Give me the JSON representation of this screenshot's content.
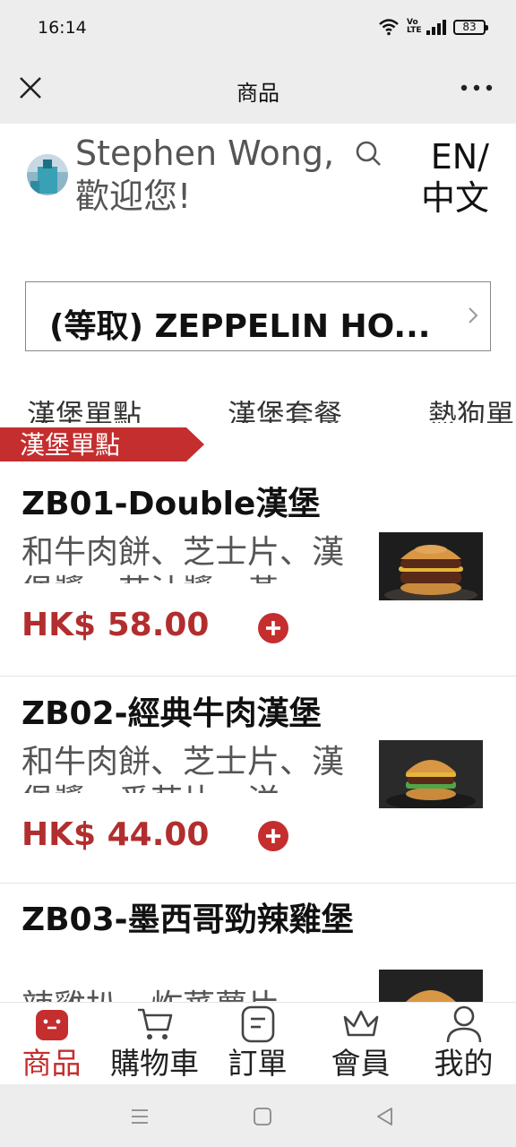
{
  "status_bar": {
    "time": "16:14",
    "network": "Vo LTE",
    "battery": "83"
  },
  "title_bar": {
    "title": "商品"
  },
  "welcome": {
    "name_line": "Stephen Wong,",
    "greeting_line": "歡迎您!",
    "lang_line1": "EN/",
    "lang_line2": "中文"
  },
  "store": {
    "name": "(等取) ZEPPELIN HO..."
  },
  "category_tabs": [
    "漢堡單點",
    "漢堡套餐",
    "熱狗單"
  ],
  "section_label": "漢堡單點",
  "accent_color": "#c42e2e",
  "products": [
    {
      "name": "ZB01-Double漢堡",
      "description": "和牛肉餅、芝士片、漢堡醬、茄汁醬、黃",
      "price": "HK$ 58.00"
    },
    {
      "name": "ZB02-經典牛肉漢堡",
      "description": "和牛肉餅、芝士片、漢堡醬、番茄片、洋",
      "price": "HK$ 44.00"
    },
    {
      "name": "ZB03-墨西哥勁辣雞堡",
      "description": "辣雞扒、炸蕃薯片",
      "price": ""
    }
  ],
  "bottom_nav": [
    {
      "label": "商品",
      "icon": "product-bag-icon",
      "active": true
    },
    {
      "label": "購物車",
      "icon": "cart-icon",
      "active": false
    },
    {
      "label": "訂單",
      "icon": "order-icon",
      "active": false
    },
    {
      "label": "會員",
      "icon": "crown-icon",
      "active": false
    },
    {
      "label": "我的",
      "icon": "profile-icon",
      "active": false
    }
  ]
}
